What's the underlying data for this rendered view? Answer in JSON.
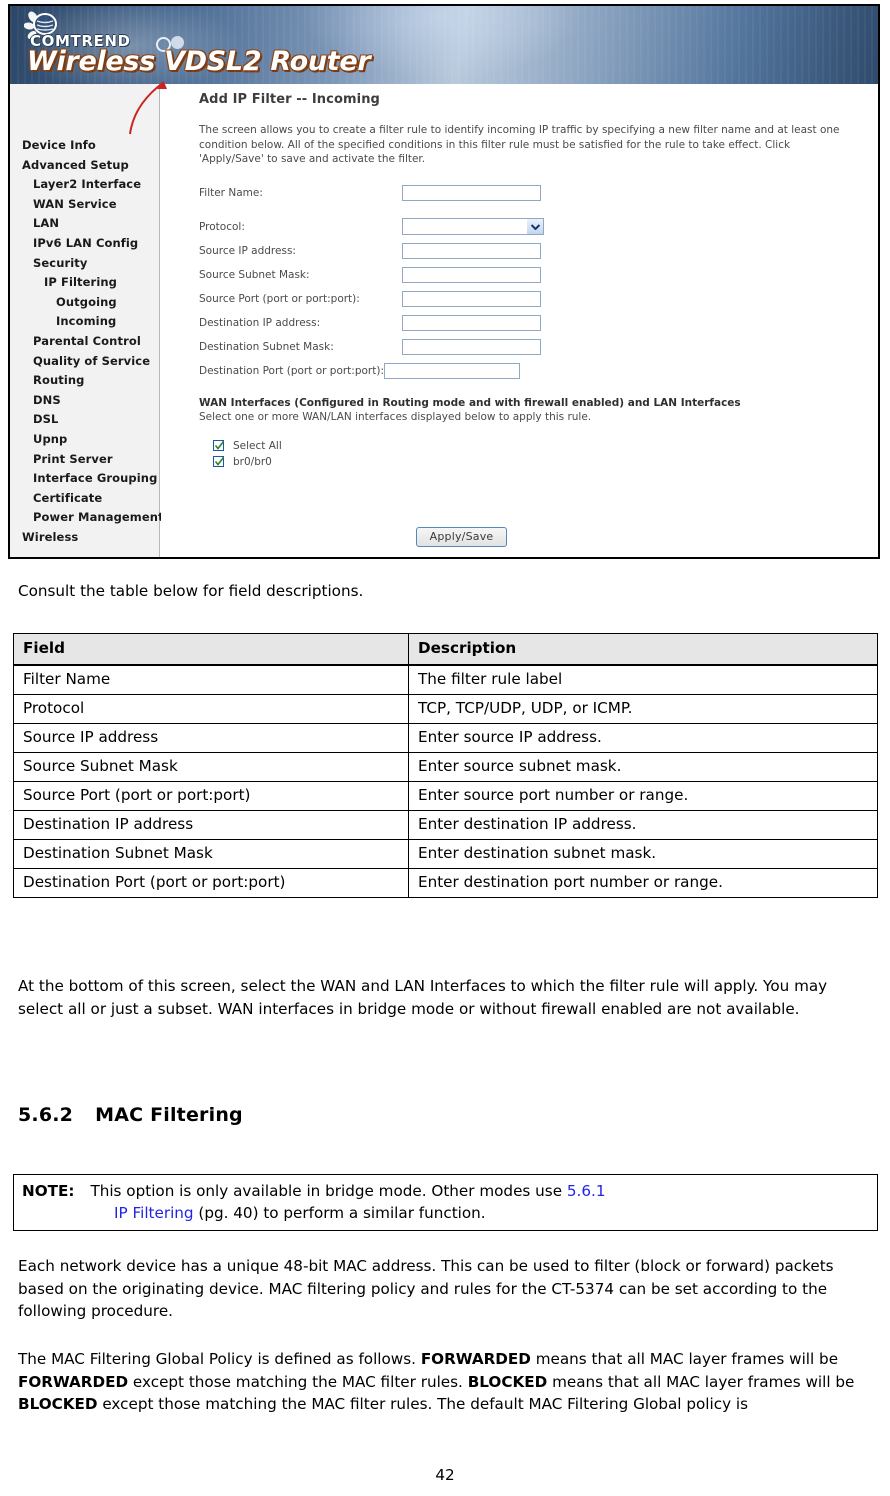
{
  "router_screenshot": {
    "banner": {
      "brand": "COMTREND",
      "product_title": "Wireless VDSL2 Router"
    },
    "sidebar": {
      "items": [
        {
          "label": "Device Info",
          "level": 1
        },
        {
          "label": "Advanced Setup",
          "level": 1
        },
        {
          "label": "Layer2 Interface",
          "level": 2
        },
        {
          "label": "WAN Service",
          "level": 2
        },
        {
          "label": "LAN",
          "level": 2
        },
        {
          "label": "IPv6 LAN Config",
          "level": 2
        },
        {
          "label": "Security",
          "level": 2
        },
        {
          "label": "IP Filtering",
          "level": 3
        },
        {
          "label": "Outgoing",
          "level": 4
        },
        {
          "label": "Incoming",
          "level": 4
        },
        {
          "label": "Parental Control",
          "level": 2
        },
        {
          "label": "Quality of Service",
          "level": 2
        },
        {
          "label": "Routing",
          "level": 2
        },
        {
          "label": "DNS",
          "level": 2
        },
        {
          "label": "DSL",
          "level": 2
        },
        {
          "label": "Upnp",
          "level": 2
        },
        {
          "label": "Print Server",
          "level": 2
        },
        {
          "label": "Interface Grouping",
          "level": 2
        },
        {
          "label": "Certificate",
          "level": 2
        },
        {
          "label": "Power Management",
          "level": 2
        },
        {
          "label": "Wireless",
          "level": 1
        }
      ]
    },
    "page": {
      "heading": "Add IP Filter -- Incoming",
      "description": "The screen allows you to create a filter rule to identify incoming IP traffic by specifying a new filter name and at least one condition below. All of the specified conditions in this filter rule must be satisfied for the rule to take effect. Click 'Apply/Save' to save and activate the filter.",
      "fields": {
        "filter_name_label": "Filter Name:",
        "filter_name_value": "",
        "protocol_label": "Protocol:",
        "protocol_value": "",
        "source_ip_label": "Source IP address:",
        "source_ip_value": "",
        "source_mask_label": "Source Subnet Mask:",
        "source_mask_value": "",
        "source_port_label": "Source Port (port or port:port):",
        "source_port_value": "",
        "dest_ip_label": "Destination IP address:",
        "dest_ip_value": "",
        "dest_mask_label": "Destination Subnet Mask:",
        "dest_mask_value": "",
        "dest_port_label": "Destination Port (port or port:port):",
        "dest_port_value": ""
      },
      "interfaces": {
        "title": "WAN Interfaces (Configured in Routing mode and with firewall enabled) and LAN Interfaces",
        "subtitle": "Select one or more WAN/LAN interfaces displayed below to apply this rule.",
        "checkboxes": [
          {
            "label": "Select All",
            "checked": true
          },
          {
            "label": "br0/br0",
            "checked": true
          }
        ]
      },
      "apply_button": "Apply/Save"
    }
  },
  "document": {
    "consult_line": "Consult the table below for field descriptions.",
    "table": {
      "headers": [
        "Field",
        "Description"
      ],
      "rows": [
        [
          "Filter Name",
          "The filter rule label"
        ],
        [
          "Protocol",
          "TCP, TCP/UDP, UDP, or ICMP."
        ],
        [
          "Source IP address",
          "Enter source IP address."
        ],
        [
          "Source Subnet Mask",
          "Enter source subnet mask."
        ],
        [
          "Source Port (port or port:port)",
          "Enter source port number or range."
        ],
        [
          "Destination IP address",
          "Enter destination IP address."
        ],
        [
          "Destination Subnet Mask",
          "Enter destination subnet mask."
        ],
        [
          "Destination Port (port or port:port)",
          "Enter destination port number or range."
        ]
      ]
    },
    "paragraph_bottom": "At the bottom of this screen, select the WAN and LAN Interfaces to which the filter rule will apply. You may select all or just a subset. WAN interfaces in bridge mode or without firewall enabled are not available.",
    "section_heading": {
      "number": "5.6.2",
      "title": "MAC Filtering"
    },
    "note": {
      "label": "NOTE:",
      "line1_pre": "This option is only available in bridge mode. Other modes use ",
      "line1_link": "5.6.1",
      "line2_link": "IP Filtering",
      "line2_post": " (pg. 40) to perform a similar function."
    },
    "paragraph_mac_1": "Each network device has a unique 48-bit MAC address. This can be used to filter (block or forward) packets based on the originating device. MAC filtering policy and rules for the CT-5374 can be set according to the following procedure.",
    "paragraph_mac_2": {
      "t1": "The MAC Filtering Global Policy is defined as follows. ",
      "b1": "FORWARDED",
      "t2": " means that all MAC layer frames will be ",
      "b2": "FORWARDED",
      "t3": " except those matching the MAC filter rules. ",
      "b3": "BLOCKED",
      "t4": " means that all MAC layer frames will be ",
      "b4": "BLOCKED",
      "t5": " except those matching the MAC filter rules. The default MAC Filtering Global policy is"
    },
    "page_number": "42"
  },
  "colors": {
    "link": "#2323e6",
    "table_header_bg": "#e6e6e6",
    "input_border": "#8fa8c4",
    "checkbox_border": "#1f54a8",
    "checkbox_check": "#2e8b2e"
  }
}
